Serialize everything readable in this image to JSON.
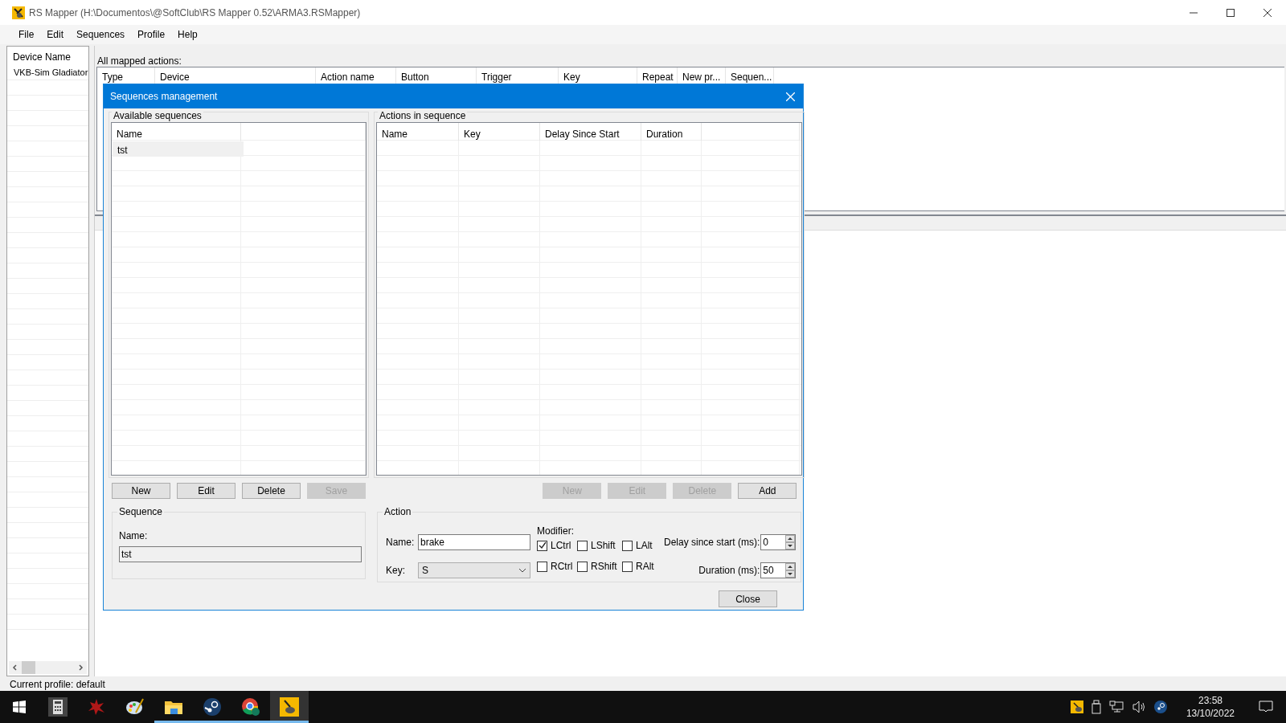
{
  "window": {
    "title": "RS Mapper (H:\\Documentos\\@SoftClub\\RS Mapper 0.52\\ARMA3.RSMapper)"
  },
  "menu": [
    "File",
    "Edit",
    "Sequences",
    "Profile",
    "Help"
  ],
  "devices": {
    "column": "Device Name",
    "items": [
      {
        "label": "VKB-Sim Gladiator"
      }
    ]
  },
  "mapped_actions": {
    "label": "All mapped actions:",
    "columns": [
      "Type",
      "Device",
      "Action name",
      "Button",
      "Trigger",
      "Key",
      "Repeat",
      "New pr...",
      "Sequen..."
    ]
  },
  "dialog": {
    "title": "Sequences management",
    "available_sequences": {
      "label": "Available sequences",
      "columns": [
        "Name"
      ],
      "rows": [
        {
          "name": "tst",
          "selected": true
        }
      ]
    },
    "sequence_buttons": [
      {
        "label": "New",
        "disabled": false
      },
      {
        "label": "Edit",
        "disabled": false
      },
      {
        "label": "Delete",
        "disabled": false
      },
      {
        "label": "Save",
        "disabled": true
      }
    ],
    "sequence": {
      "label": "Sequence",
      "name_label": "Name:",
      "name_value": "tst"
    },
    "actions_in_sequence": {
      "label": "Actions in sequence",
      "columns": [
        "Name",
        "Key",
        "Delay Since Start",
        "Duration"
      ]
    },
    "action_buttons": [
      {
        "label": "New",
        "disabled": true
      },
      {
        "label": "Edit",
        "disabled": true
      },
      {
        "label": "Delete",
        "disabled": true
      },
      {
        "label": "Add",
        "disabled": false
      }
    ],
    "action": {
      "label": "Action",
      "name_label": "Name:",
      "name_value": "brake",
      "key_label": "Key:",
      "key_value": "S",
      "modifier_label": "Modifier:",
      "modifiers": [
        {
          "label": "LCtrl",
          "checked": true
        },
        {
          "label": "LShift",
          "checked": false
        },
        {
          "label": "LAlt",
          "checked": false
        },
        {
          "label": "RCtrl",
          "checked": false
        },
        {
          "label": "RShift",
          "checked": false
        },
        {
          "label": "RAlt",
          "checked": false
        }
      ],
      "delay_label": "Delay since start (ms):",
      "delay_value": "0",
      "duration_label": "Duration (ms):",
      "duration_value": "50"
    },
    "close_button": "Close"
  },
  "status_bar": "Current profile: default",
  "taskbar": {
    "apps": [
      {
        "kind": "calculator",
        "running": false,
        "selected": false
      },
      {
        "kind": "splat",
        "running": false,
        "selected": false
      },
      {
        "kind": "paint",
        "running": false,
        "selected": false
      },
      {
        "kind": "folder",
        "running": true,
        "selected": false
      },
      {
        "kind": "steam",
        "running": true,
        "selected": false
      },
      {
        "kind": "chrome",
        "running": true,
        "selected": false
      },
      {
        "kind": "mapper",
        "running": true,
        "selected": true
      }
    ],
    "time": "23:58",
    "date": "13/10/2022"
  }
}
